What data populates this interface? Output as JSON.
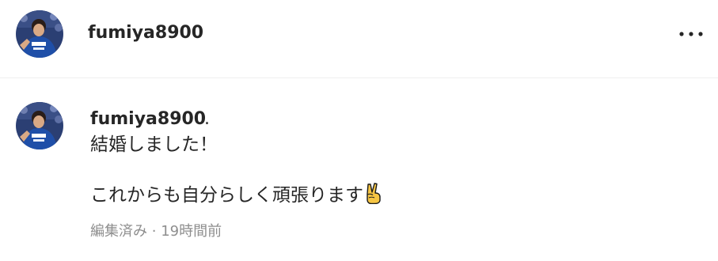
{
  "header": {
    "username": "fumiya8900",
    "more_icon": "more-horizontal-icon"
  },
  "comment": {
    "username": "fumiya8900",
    "separator": ".",
    "lines": [
      "結婚しました！",
      "これからも自分らしく頑張ります"
    ],
    "emoji_icon": "victory-hand-icon",
    "edited": "編集済み",
    "meta_separator": "·",
    "time": "19時間前"
  },
  "colors": {
    "text": "#262626",
    "muted": "#8e8e8e",
    "divider": "#efefef",
    "jersey": "#1f4fa8"
  }
}
